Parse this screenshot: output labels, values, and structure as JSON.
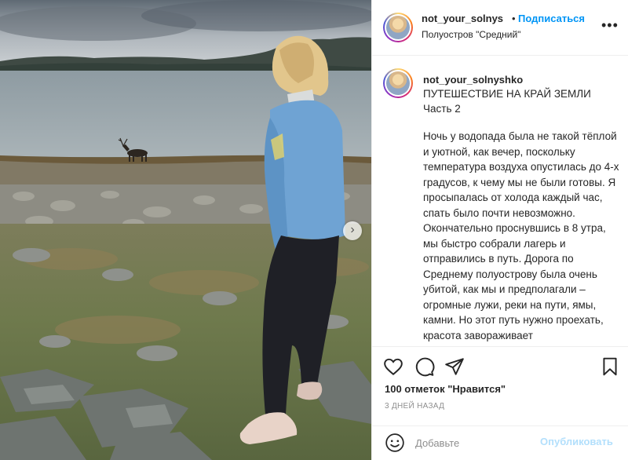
{
  "post": {
    "username": "not_your_solnys",
    "separator": "•",
    "follow_label": "Подписаться",
    "location": "Полуостров \"Средний\"",
    "more_icon": "more-horizontal-icon"
  },
  "caption": {
    "username": "not_your_solnyshko",
    "title": "ПУТЕШЕСТВИЕ НА КРАЙ ЗЕМЛИ",
    "part": "Часть 2",
    "body": "Ночь у водопада была не такой тёплой и уютной, как вечер, поскольку температура воздуха опустилась до 4-х градусов, к чему мы не были готовы. Я просыпалась от холода каждый час, спать было почти невозможно. Окончательно проснувшись в 8 утра, мы быстро собрали лагерь и отправились в путь. Дорога по Среднему полуострову была очень убитой, как мы и предполагали – огромные лужи, реки на пути, ямы, камни. Но этот путь нужно проехать, красота завораживает"
  },
  "actions": {
    "like_icon": "heart-icon",
    "comment_icon": "comment-icon",
    "share_icon": "send-icon",
    "save_icon": "bookmark-icon",
    "likes_text": "100 отметок \"Нравится\"",
    "time_text": "3 ДНЕЙ НАЗАД"
  },
  "comment": {
    "emoji_icon": "emoji-icon",
    "placeholder": "Добавьте",
    "publish_label": "Опубликовать"
  },
  "carousel": {
    "next_icon": "chevron-right-icon",
    "next_glyph": "›"
  },
  "colors": {
    "link_blue": "#0095f6",
    "publish_disabled": "#b2dffc",
    "meta_gray": "#8e8e8e"
  }
}
